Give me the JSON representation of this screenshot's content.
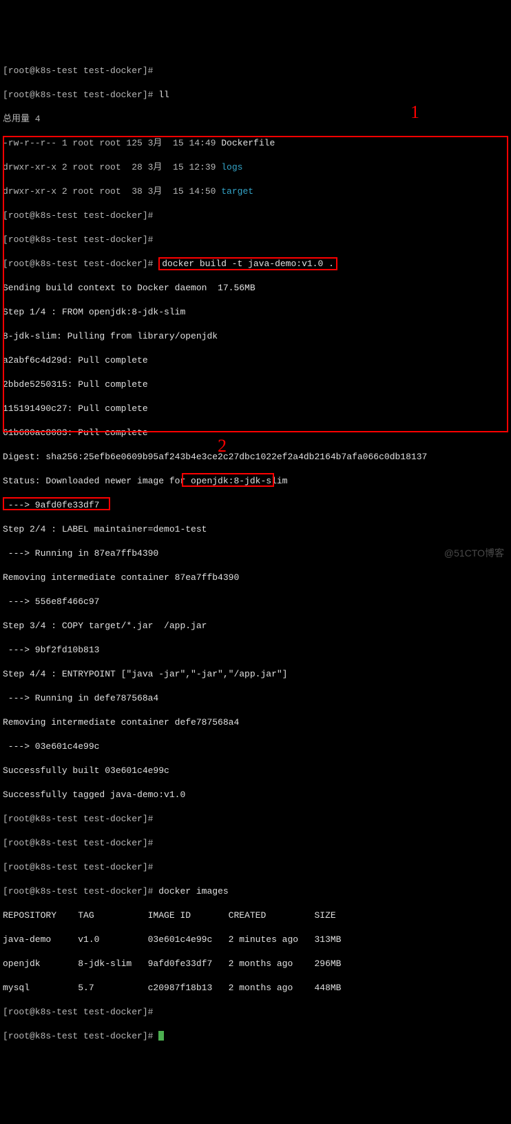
{
  "prompt": "[root@k8s-test test-docker]#",
  "ll_cmd": "ll",
  "total_line": "总用量 4",
  "ls": {
    "file1_perm": "-rw-r--r-- 1 root root 125 3月  15 14:49 ",
    "file1_name": "Dockerfile",
    "dir1_perm": "drwxr-xr-x 2 root root  28 3月  15 12:39 ",
    "dir1_name": "logs",
    "dir2_perm": "drwxr-xr-x 2 root root  38 3月  15 14:50 ",
    "dir2_name": "target"
  },
  "cmd_build": "docker build -t java-demo:v1.0 .",
  "build_out": {
    "l1": "Sending build context to Docker daemon  17.56MB",
    "l2": "Step 1/4 : FROM openjdk:8-jdk-slim",
    "l3": "8-jdk-slim: Pulling from library/openjdk",
    "l4": "a2abf6c4d29d: Pull complete",
    "l5": "2bbde5250315: Pull complete",
    "l6": "115191490c27: Pull complete",
    "l7": "61b680ac8083: Pull complete",
    "l8": "Digest: sha256:25efb6e0609b95af243b4e3ce2c27dbc1022ef2a4db2164b7afa066c0db18137",
    "l9": "Status: Downloaded newer image for openjdk:8-jdk-slim",
    "l10": " ---> 9afd0fe33df7",
    "l11": "Step 2/4 : LABEL maintainer=demo1-test",
    "l12": " ---> Running in 87ea7ffb4390",
    "l13": "Removing intermediate container 87ea7ffb4390",
    "l14": " ---> 556e8f466c97",
    "l15": "Step 3/4 : COPY target/*.jar  /app.jar",
    "l16": " ---> 9bf2fd10b813",
    "l17": "Step 4/4 : ENTRYPOINT [\"java -jar\",\"-jar\",\"/app.jar\"]",
    "l18": " ---> Running in defe787568a4",
    "l19": "Removing intermediate container defe787568a4",
    "l20": " ---> 03e601c4e99c",
    "l21": "Successfully built 03e601c4e99c",
    "l22": "Successfully tagged java-demo:v1.0"
  },
  "cmd_images": "docker images",
  "images": {
    "hdr": "REPOSITORY    TAG          IMAGE ID       CREATED         SIZE",
    "row1": "java-demo     v1.0         03e601c4e99c   2 minutes ago   313MB",
    "row2": "openjdk       8-jdk-slim   9afd0fe33df7   2 months ago    296MB",
    "row3": "mysql         5.7          c20987f18b13   2 months ago    448MB"
  },
  "anno1": "1",
  "anno2": "2",
  "watermark": "@51CTO博客"
}
